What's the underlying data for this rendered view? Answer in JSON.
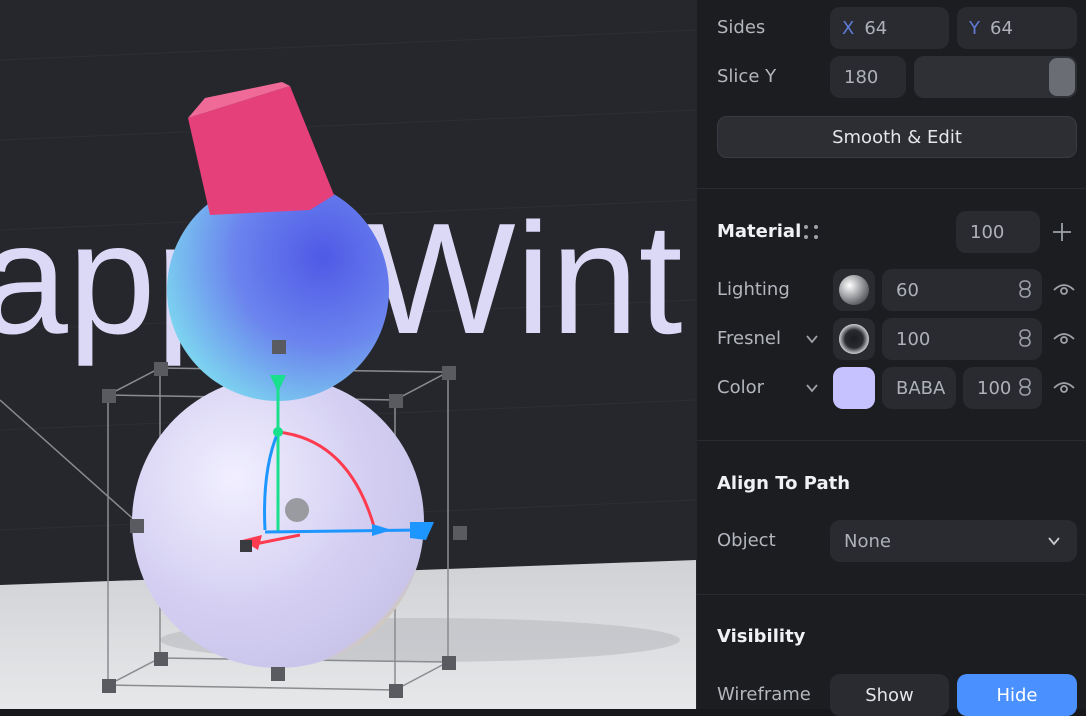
{
  "viewport": {
    "scene_text": "appy Wint",
    "colors": {
      "background": "#26272c",
      "floor": "#d8dadd",
      "text": "#dcd9f7",
      "hat": "#e5407a",
      "head": "#6f8cf0",
      "body": "#dcd7f5",
      "gizmo_x": "#ff3b4f",
      "gizmo_y": "#18e08c",
      "gizmo_z": "#1e96ff"
    }
  },
  "panel": {
    "sides": {
      "label": "Sides",
      "x_axis": "X",
      "x_value": "64",
      "y_axis": "Y",
      "y_value": "64"
    },
    "slice": {
      "label": "Slice Y",
      "value": "180",
      "slider_fraction": 1.0
    },
    "smooth_button": "Smooth & Edit",
    "material": {
      "title": "Material",
      "opacity_value": "100",
      "lighting": {
        "label": "Lighting",
        "value": "60"
      },
      "fresnel": {
        "label": "Fresnel",
        "value": "100"
      },
      "color": {
        "label": "Color",
        "hex": "BABA",
        "opacity": "100",
        "swatch": "#c6c1ff"
      },
      "icons": [
        "grip-icon",
        "plus-icon",
        "link-icon",
        "eye-icon",
        "chevron-down-icon"
      ]
    },
    "align": {
      "title": "Align To Path",
      "object_label": "Object",
      "object_value": "None"
    },
    "visibility": {
      "title": "Visibility",
      "wireframe_label": "Wireframe",
      "show_label": "Show",
      "hide_label": "Hide",
      "accent": "#4a90ff"
    }
  }
}
